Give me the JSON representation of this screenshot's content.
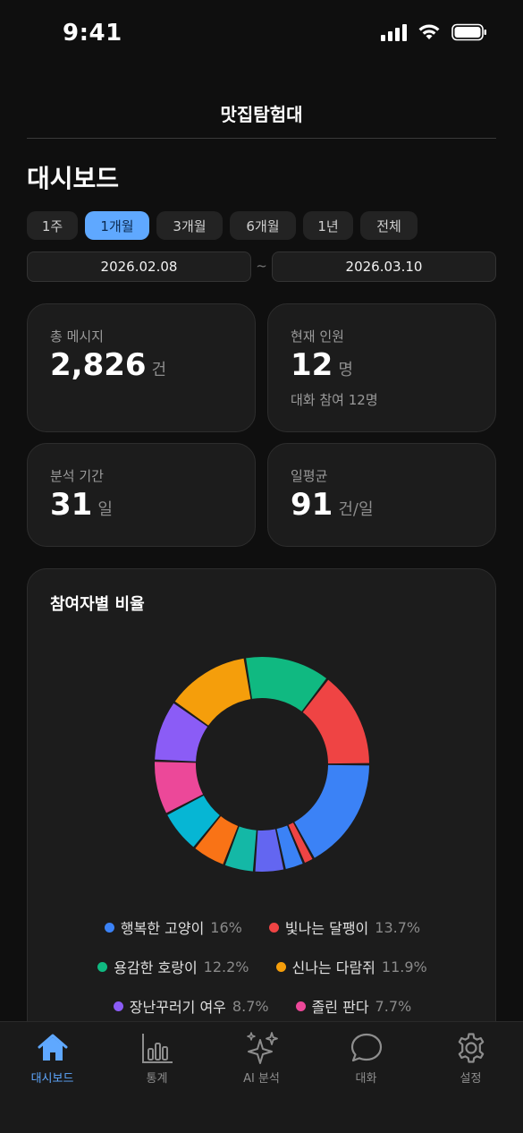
{
  "status_bar": {
    "time": "9:41"
  },
  "header": {
    "title": "맛집탐험대"
  },
  "page": {
    "title": "대시보드"
  },
  "periods": [
    {
      "label": "1주",
      "active": false
    },
    {
      "label": "1개월",
      "active": true
    },
    {
      "label": "3개월",
      "active": false
    },
    {
      "label": "6개월",
      "active": false
    },
    {
      "label": "1년",
      "active": false
    },
    {
      "label": "전체",
      "active": false
    }
  ],
  "date_range": {
    "start": "2026.02.08",
    "separator": "~",
    "end": "2026.03.10"
  },
  "stats": {
    "total_messages": {
      "label": "총 메시지",
      "value": "2,826",
      "unit": "건"
    },
    "current_members": {
      "label": "현재 인원",
      "value": "12",
      "unit": "명",
      "sub": "대화 참여 12명"
    },
    "period": {
      "label": "분석 기간",
      "value": "31",
      "unit": "일"
    },
    "daily_avg": {
      "label": "일평균",
      "value": "91",
      "unit": "건/일"
    }
  },
  "chart_data": {
    "type": "pie",
    "title": "참여자별 비율",
    "donut": true,
    "slices": [
      {
        "name": "행복한 고양이",
        "value": 16.0,
        "pct_label": "16%",
        "color": "#3b82f6"
      },
      {
        "name": "",
        "value": 1.5,
        "color": "#ef4444"
      },
      {
        "name": "",
        "value": 2.8,
        "color": "#3b82f6"
      },
      {
        "name": "",
        "value": 4.3,
        "color": "#6366f1"
      },
      {
        "name": "",
        "value": 4.3,
        "color": "#14b8a6"
      },
      {
        "name": "",
        "value": 4.8,
        "color": "#f97316"
      },
      {
        "name": "",
        "value": 6.1,
        "color": "#06b6d4"
      },
      {
        "name": "졸린 판다",
        "value": 7.7,
        "pct_label": "7.7%",
        "color": "#ec4899"
      },
      {
        "name": "장난꾸러기 여우",
        "value": 8.7,
        "pct_label": "8.7%",
        "color": "#8b5cf6"
      },
      {
        "name": "신나는 다람쥐",
        "value": 11.9,
        "pct_label": "11.9%",
        "color": "#f59e0b"
      },
      {
        "name": "용감한 호랑이",
        "value": 12.2,
        "pct_label": "12.2%",
        "color": "#10b981"
      },
      {
        "name": "빛나는 달팽이",
        "value": 13.7,
        "pct_label": "13.7%",
        "color": "#ef4444"
      }
    ],
    "legend": [
      {
        "name": "행복한 고양이",
        "pct": "16%",
        "color": "#3b82f6"
      },
      {
        "name": "빛나는 달팽이",
        "pct": "13.7%",
        "color": "#ef4444"
      },
      {
        "name": "용감한 호랑이",
        "pct": "12.2%",
        "color": "#10b981"
      },
      {
        "name": "신나는 다람쥐",
        "pct": "11.9%",
        "color": "#f59e0b"
      },
      {
        "name": "장난꾸러기 여우",
        "pct": "8.7%",
        "color": "#8b5cf6"
      },
      {
        "name": "졸린 판다",
        "pct": "7.7%",
        "color": "#ec4899"
      }
    ]
  },
  "tab_bar": {
    "items": [
      {
        "label": "대시보드",
        "icon": "home-icon",
        "active": true
      },
      {
        "label": "통계",
        "icon": "bar-chart-icon",
        "active": false
      },
      {
        "label": "AI 분석",
        "icon": "sparkles-icon",
        "active": false
      },
      {
        "label": "대화",
        "icon": "chat-bubble-icon",
        "active": false
      },
      {
        "label": "설정",
        "icon": "gear-icon",
        "active": false
      }
    ]
  },
  "colors": {
    "accent": "#5fa8ff",
    "background": "#0f0f0f",
    "card": "#1c1c1c"
  }
}
